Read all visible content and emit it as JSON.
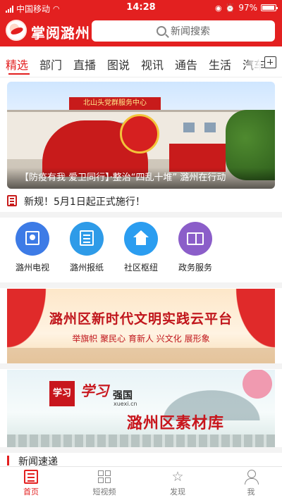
{
  "status_bar": {
    "carrier": "中国移动",
    "time": "14:28",
    "battery": "97%"
  },
  "header": {
    "app_title": "掌阅潞州",
    "search_placeholder": "新闻搜索"
  },
  "tabs": [
    "精选",
    "部门",
    "直播",
    "图说",
    "视讯",
    "通告",
    "生活",
    "汽车"
  ],
  "hero": {
    "caption": "【防疫有我 爱卫同行】·整治“四乱十堆” 潞州在行动",
    "sign_text": "北山头党群服务中心"
  },
  "ticker": {
    "text": "新规！5月1日起正式施行！"
  },
  "quick_links": [
    {
      "label": "潞州电视",
      "icon": "tv-icon",
      "color": "#3d7be6"
    },
    {
      "label": "潞州报纸",
      "icon": "newspaper-icon",
      "color": "#2e9be8"
    },
    {
      "label": "社区枢纽",
      "icon": "home-icon",
      "color": "#2b9df0"
    },
    {
      "label": "政务服务",
      "icon": "book-icon",
      "color": "#8b5ec9"
    }
  ],
  "banner1": {
    "title": "潞州区新时代文明实践云平台",
    "subtitle": "举旗帜 聚民心 育新人 兴文化 展形象"
  },
  "banner2": {
    "logo": "学习",
    "brand": "学习",
    "brand2": "强国",
    "url": "xuexi.cn",
    "title": "潞州区素材库"
  },
  "section": {
    "title": "新闻速递"
  },
  "bottom_nav": [
    {
      "label": "首页",
      "icon": "home-doc-icon"
    },
    {
      "label": "短视频",
      "icon": "grid-icon"
    },
    {
      "label": "发现",
      "icon": "star-icon"
    },
    {
      "label": "我",
      "icon": "user-icon"
    }
  ],
  "colors": {
    "brand_red": "#e32020"
  }
}
